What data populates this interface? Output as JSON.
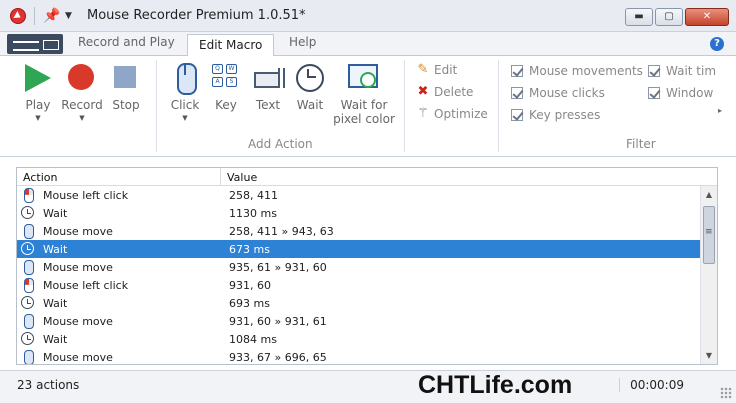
{
  "window": {
    "title": "Mouse Recorder Premium 1.0.51*",
    "buttons": {
      "minimize": "▬",
      "maximize": "▢",
      "close": "✕"
    }
  },
  "tabs": [
    "Record and Play",
    "Edit Macro",
    "Help"
  ],
  "active_tab": "Edit Macro",
  "ribbon": {
    "playback": {
      "play": "Play",
      "record": "Record",
      "stop": "Stop"
    },
    "add_action": {
      "click": "Click",
      "key": "Key",
      "text": "Text",
      "wait": "Wait",
      "pixel_line1": "Wait for",
      "pixel_line2": "pixel color",
      "group_label": "Add Action"
    },
    "edit": {
      "edit": "Edit",
      "delete": "Delete",
      "optimize": "Optimize"
    },
    "filter": {
      "mouse_movements": "Mouse movements",
      "mouse_clicks": "Mouse clicks",
      "key_presses": "Key presses",
      "wait_times": "Wait tim",
      "windows": "Window",
      "group_label": "Filter"
    }
  },
  "list": {
    "columns": {
      "action": "Action",
      "value": "Value"
    },
    "rows": [
      {
        "icon": "mouse-left",
        "action": "Mouse left click",
        "value": "258, 411"
      },
      {
        "icon": "clock",
        "action": "Wait",
        "value": "1130 ms"
      },
      {
        "icon": "mouse",
        "action": "Mouse move",
        "value": "258, 411 » 943, 63"
      },
      {
        "icon": "clock",
        "action": "Wait",
        "value": "673 ms",
        "selected": true
      },
      {
        "icon": "mouse",
        "action": "Mouse move",
        "value": "935, 61 » 931, 60"
      },
      {
        "icon": "mouse-left",
        "action": "Mouse left click",
        "value": "931, 60"
      },
      {
        "icon": "clock",
        "action": "Wait",
        "value": "693 ms"
      },
      {
        "icon": "mouse",
        "action": "Mouse move",
        "value": "931, 60 » 931, 61"
      },
      {
        "icon": "clock",
        "action": "Wait",
        "value": "1084 ms"
      },
      {
        "icon": "mouse",
        "action": "Mouse move",
        "value": "933, 67 » 696, 65"
      }
    ]
  },
  "status": {
    "count": "23 actions",
    "watermark": "CHTLife.com",
    "time": "00:00:09"
  }
}
